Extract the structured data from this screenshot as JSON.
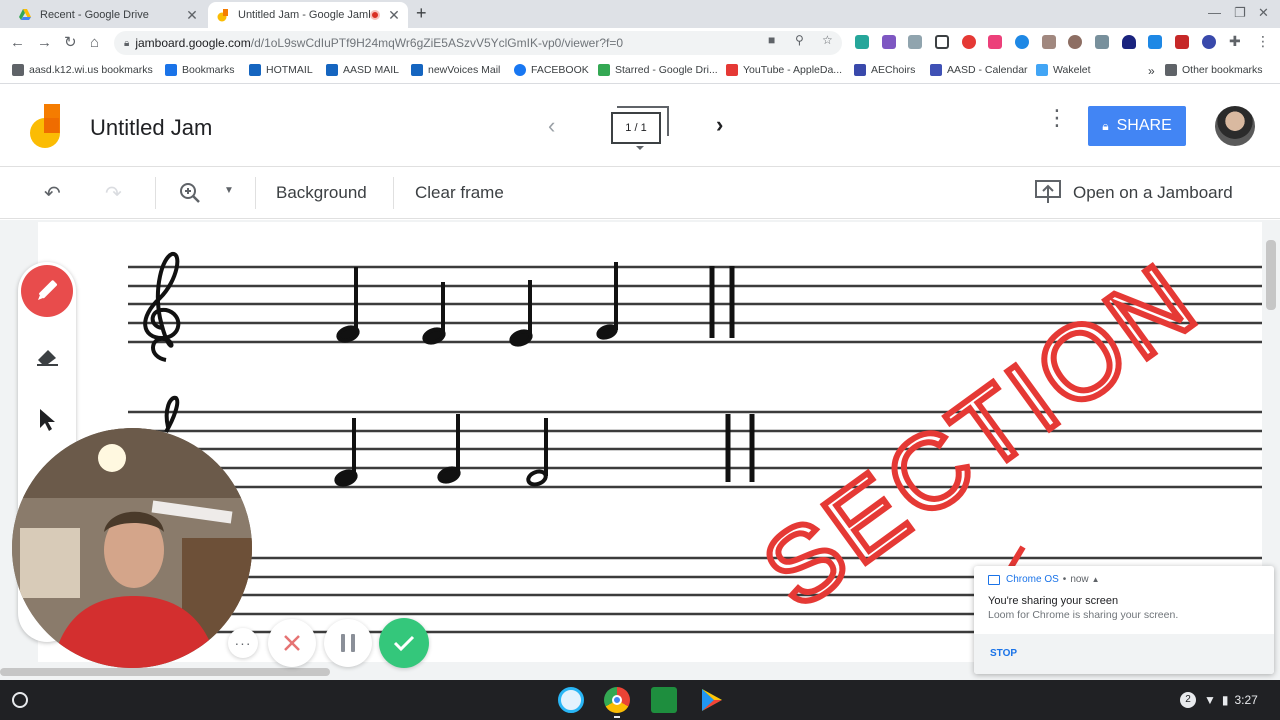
{
  "browser": {
    "tabs": [
      {
        "title": "Recent - Google Drive",
        "active": false
      },
      {
        "title": "Untitled Jam - Google Jamboard",
        "active": true
      }
    ],
    "url_host": "jamboard.google.com",
    "url_path": "/d/1oL9swCdIuPTf9H24mqWr6gZiE5ASzvV5YclGmIK-vp0/viewer?f=0",
    "bookmarks": [
      {
        "label": "aasd.k12.wi.us bookmarks",
        "color": "#5f6368"
      },
      {
        "label": "Bookmarks",
        "color": "#1a73e8"
      },
      {
        "label": "HOTMAIL",
        "color": "#1565c0"
      },
      {
        "label": "AASD MAIL",
        "color": "#1565c0"
      },
      {
        "label": "newVoices Mail",
        "color": "#1565c0"
      },
      {
        "label": "FACEBOOK",
        "color": "#1877f2"
      },
      {
        "label": "Starred - Google Dri...",
        "color": "#34a853"
      },
      {
        "label": "YouTube - AppleDa...",
        "color": "#e53935"
      },
      {
        "label": "AEChoirs",
        "color": "#3949ab"
      },
      {
        "label": "AASD - Calendar",
        "color": "#3f51b5"
      },
      {
        "label": "Wakelet",
        "color": "#42a5f5"
      }
    ],
    "bookmarks_overflow": "»",
    "other_bookmarks": "Other bookmarks"
  },
  "jam": {
    "title": "Untitled Jam",
    "frame_counter": "1 / 1",
    "share_label": "SHARE",
    "toolbar": {
      "background_label": "Background",
      "clear_frame_label": "Clear frame",
      "open_on_jamboard_label": "Open on a Jamboard"
    },
    "canvas_annotation": "SECTION",
    "accent_color": "#4285f4",
    "pen_color": "#e84c4c"
  },
  "notification": {
    "app": "Chrome OS",
    "time": "now",
    "title": "You're sharing your screen",
    "body": "Loom for Chrome is sharing your screen.",
    "action": "STOP"
  },
  "shelf": {
    "notification_count": "2",
    "time": "3:27"
  }
}
